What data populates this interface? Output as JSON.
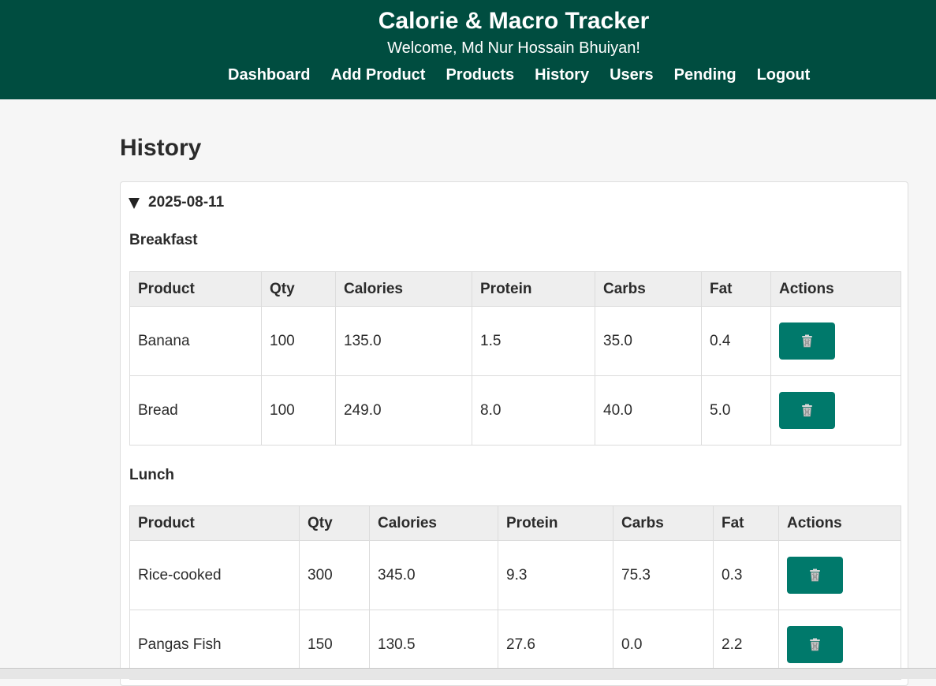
{
  "header": {
    "title": "Calorie & Macro Tracker",
    "welcome": "Welcome, Md Nur Hossain Bhuiyan!",
    "nav": [
      "Dashboard",
      "Add Product",
      "Products",
      "History",
      "Users",
      "Pending",
      "Logout"
    ]
  },
  "page": {
    "title": "History"
  },
  "history": {
    "date": "2025-08-11",
    "columns": [
      "Product",
      "Qty",
      "Calories",
      "Protein",
      "Carbs",
      "Fat",
      "Actions"
    ],
    "meals": [
      {
        "name": "Breakfast",
        "rows": [
          [
            "Banana",
            "100",
            "135.0",
            "1.5",
            "35.0",
            "0.4"
          ],
          [
            "Bread",
            "100",
            "249.0",
            "8.0",
            "40.0",
            "5.0"
          ]
        ]
      },
      {
        "name": "Lunch",
        "rows": [
          [
            "Rice-cooked",
            "300",
            "345.0",
            "9.3",
            "75.3",
            "0.3"
          ],
          [
            "Pangas Fish",
            "150",
            "130.5",
            "27.6",
            "0.0",
            "2.2"
          ]
        ]
      }
    ]
  },
  "icons": {
    "delete": "trash-icon"
  },
  "colors": {
    "header_bg": "#004d40",
    "button_bg": "#00796b",
    "page_bg": "#f6f6f6"
  }
}
